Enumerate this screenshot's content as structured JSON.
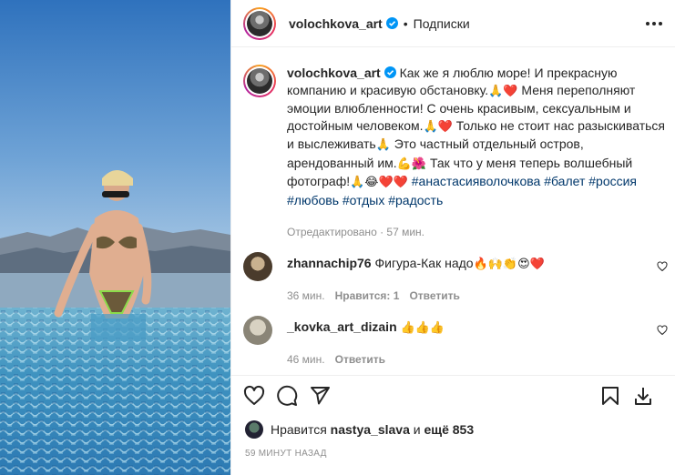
{
  "header": {
    "username": "volochkova_art",
    "separator": "•",
    "follow_label": "Подписки"
  },
  "caption": {
    "username": "volochkova_art",
    "text_parts": [
      "Как же я люблю море! И прекрасную компанию и красивую обстановку.",
      "🙏❤️",
      " Меня переполняют эмоции влюбленности! С очень красивым, сексуальным и достойным человеком.",
      "🙏❤️",
      " Только не стоит нас разыскиваться и выслеживать",
      "🙏",
      " Это частный отдельный остров, арендованный им.",
      "💪🌺",
      " Так что у меня теперь волшебный фотограф!",
      "🙏😂❤️❤️"
    ],
    "hashtags": [
      "#анастасияволочкова",
      "#балет",
      "#россия",
      "#любовь",
      "#отдых",
      "#радость"
    ],
    "edited": "Отредактировано · 57 мин."
  },
  "comments": [
    {
      "username": "zhannachip76",
      "text": "Фигура-Как надо",
      "emoji": "🔥🙌👏😍❤️",
      "time": "36 мин.",
      "likes": "Нравится: 1",
      "reply": "Ответить"
    },
    {
      "username": "_kovka_art_dizain",
      "text": "",
      "emoji": "👍👍👍",
      "time": "46 мин.",
      "likes": "",
      "reply": "Ответить"
    }
  ],
  "likes": {
    "prefix": "Нравится",
    "user": "nastya_slava",
    "middle": "и",
    "count": "ещё 853"
  },
  "timestamp": "59 МИНУТ НАЗАД",
  "colors": {
    "text": "#262626",
    "muted": "#8e8e8e",
    "hashtag": "#00376b",
    "verified": "#0095f6",
    "heart": "#ed4956",
    "border": "#efefef"
  },
  "icons": {
    "like": "heart-icon",
    "comment": "comment-icon",
    "share": "share-icon",
    "save": "bookmark-icon",
    "download": "download-icon",
    "more": "more-icon"
  }
}
